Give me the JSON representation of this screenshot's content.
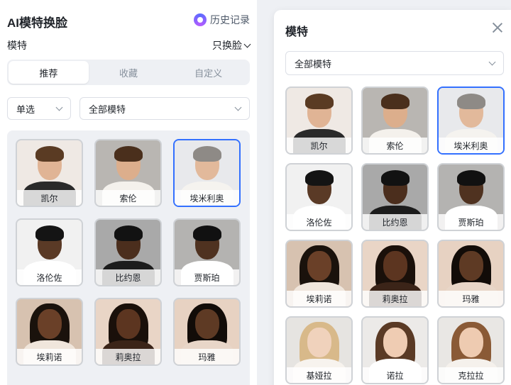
{
  "left": {
    "title": "AI模特换脸",
    "history_label": "历史记录",
    "model_label": "模特",
    "mode_label": "只换脸",
    "tabs": [
      {
        "label": "推荐"
      },
      {
        "label": "收藏"
      },
      {
        "label": "自定义"
      }
    ],
    "select_mode": "单选",
    "select_filter": "全部模特",
    "models": [
      {
        "name": "凯尔",
        "skin": "#e0b495",
        "hair": "#5a3b23",
        "shirt": "#2a2a2a",
        "bg": "#efe9e4",
        "selected": false
      },
      {
        "name": "索伦",
        "skin": "#dcae8c",
        "hair": "#4a2f1c",
        "shirt": "#f4f1ec",
        "bg": "#b9b6b2",
        "selected": false
      },
      {
        "name": "埃米利奥",
        "skin": "#e2b99b",
        "hair": "#8e8a86",
        "shirt": "#f5f3ef",
        "bg": "#e8e9ec",
        "selected": true
      },
      {
        "name": "洛伦佐",
        "skin": "#5a3a26",
        "hair": "#141414",
        "shirt": "#ffffff",
        "bg": "#f1f1f1",
        "selected": false
      },
      {
        "name": "比约恩",
        "skin": "#4b2e1d",
        "hair": "#121212",
        "shirt": "#1c1c1c",
        "bg": "#a9a9a9",
        "selected": false
      },
      {
        "name": "贾斯珀",
        "skin": "#4f3220",
        "hair": "#111111",
        "shirt": "#ffffff",
        "bg": "#b4b3b1",
        "selected": false
      },
      {
        "name": "埃莉诺",
        "skin": "#6a4028",
        "hair": "#1a120c",
        "shirt": "#f0e6dc",
        "bg": "#d7c2b0",
        "selected": false
      },
      {
        "name": "莉奥拉",
        "skin": "#5c3520",
        "hair": "#1a100a",
        "shirt": "#3b2418",
        "bg": "#e9d5c6",
        "selected": false
      },
      {
        "name": "玛雅",
        "skin": "#5e3a24",
        "hair": "#120c08",
        "shirt": "#e8d6c8",
        "bg": "#e7d2c2",
        "selected": false
      }
    ]
  },
  "right": {
    "title": "模特",
    "select_filter": "全部模特",
    "models": [
      {
        "name": "凯尔",
        "skin": "#e0b495",
        "hair": "#5a3b23",
        "shirt": "#2a2a2a",
        "bg": "#efe9e4",
        "selected": false
      },
      {
        "name": "索伦",
        "skin": "#dcae8c",
        "hair": "#4a2f1c",
        "shirt": "#f4f1ec",
        "bg": "#b9b6b2",
        "selected": false
      },
      {
        "name": "埃米利奥",
        "skin": "#e2b99b",
        "hair": "#8e8a86",
        "shirt": "#f5f3ef",
        "bg": "#e8e9ec",
        "selected": true
      },
      {
        "name": "洛伦佐",
        "skin": "#5a3a26",
        "hair": "#141414",
        "shirt": "#ffffff",
        "bg": "#f1f1f1",
        "selected": false
      },
      {
        "name": "比约恩",
        "skin": "#4b2e1d",
        "hair": "#121212",
        "shirt": "#1c1c1c",
        "bg": "#a9a9a9",
        "selected": false
      },
      {
        "name": "贾斯珀",
        "skin": "#4f3220",
        "hair": "#111111",
        "shirt": "#ffffff",
        "bg": "#b4b3b1",
        "selected": false
      },
      {
        "name": "埃莉诺",
        "skin": "#6a4028",
        "hair": "#1a120c",
        "shirt": "#f0e6dc",
        "bg": "#d7c2b0",
        "selected": false
      },
      {
        "name": "莉奥拉",
        "skin": "#5c3520",
        "hair": "#1a100a",
        "shirt": "#3b2418",
        "bg": "#e9d5c6",
        "selected": false
      },
      {
        "name": "玛雅",
        "skin": "#5e3a24",
        "hair": "#120c08",
        "shirt": "#e8d6c8",
        "bg": "#e7d2c2",
        "selected": false
      },
      {
        "name": "基娅拉",
        "skin": "#f0d2bc",
        "hair": "#d8b98a",
        "shirt": "#f7f3ee",
        "bg": "#e6e4e1",
        "selected": false
      },
      {
        "name": "诺拉",
        "skin": "#efccb3",
        "hair": "#5a3a25",
        "shirt": "#ffffff",
        "bg": "#eceae8",
        "selected": false
      },
      {
        "name": "克拉拉",
        "skin": "#eecbb1",
        "hair": "#8a5a36",
        "shirt": "#f5f1ec",
        "bg": "#e9e7e4",
        "selected": false
      }
    ]
  },
  "colors": {
    "accent": "#3370ff"
  }
}
